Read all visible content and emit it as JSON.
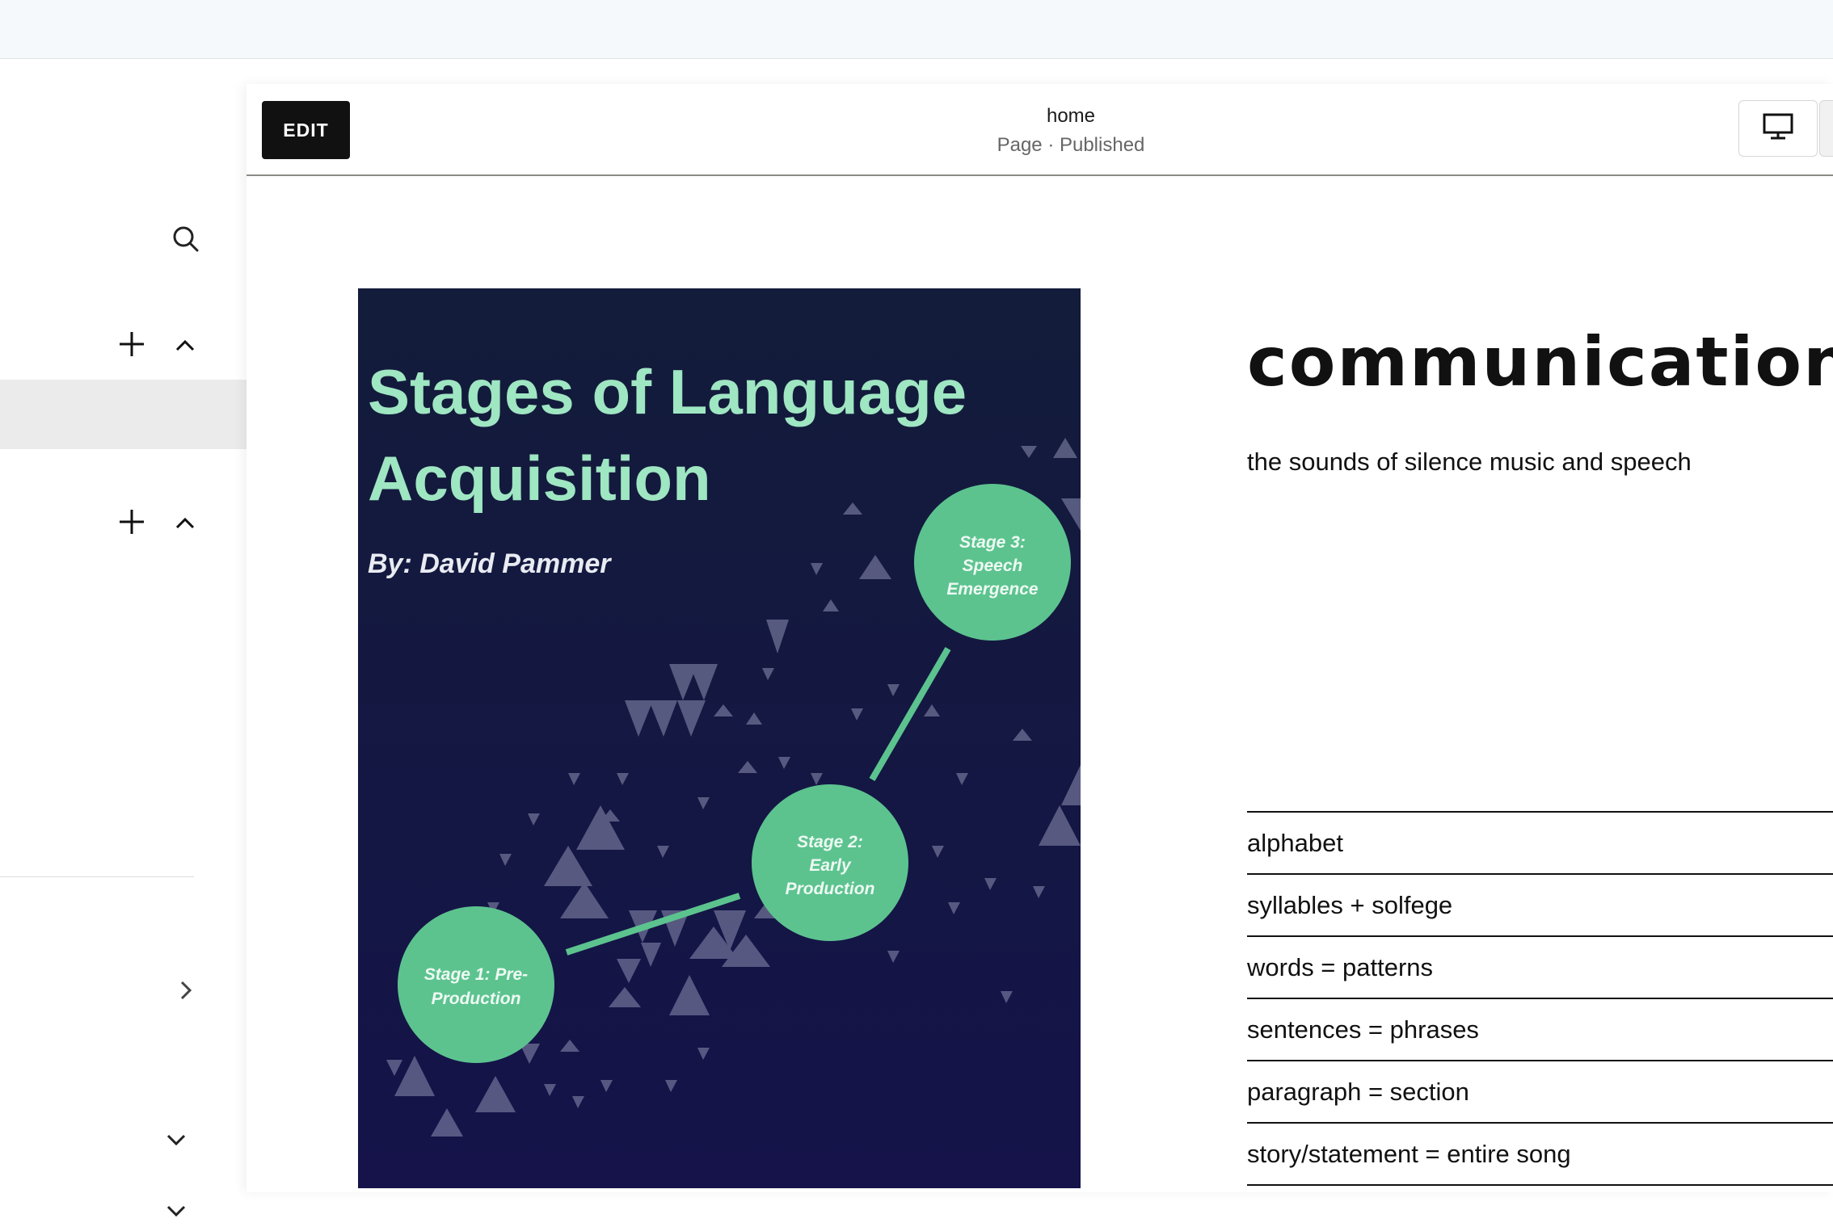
{
  "editor": {
    "edit_label": "EDIT",
    "page_name": "home",
    "page_status": "Page · Published",
    "device_icon": "desktop-icon"
  },
  "sidebar": {
    "icons": [
      "search-icon",
      "plus-icon",
      "chevron-up-icon",
      "chevron-right-icon",
      "chevron-down-icon"
    ]
  },
  "hero_image": {
    "title_line1": "Stages of Language",
    "title_line2": "Acquisition",
    "author": "By: David Pammer",
    "stages": [
      {
        "line1": "Stage 1: Pre-",
        "line2": "Production",
        "line3": ""
      },
      {
        "line1": "Stage 2:",
        "line2": "Early",
        "line3": "Production"
      },
      {
        "line1": "Stage 3:",
        "line2": "Speech",
        "line3": "Emergence"
      }
    ],
    "colors": {
      "background_top": "#131c3a",
      "background_bottom": "#15134a",
      "title": "#9fe6c2",
      "circle": "#5cc38f"
    }
  },
  "content": {
    "heading": "communication",
    "subtext": "the sounds of silence music and speech",
    "list": [
      "alphabet",
      "syllables + solfege",
      "words = patterns",
      "sentences = phrases",
      "paragraph = section",
      "story/statement = entire song"
    ]
  }
}
